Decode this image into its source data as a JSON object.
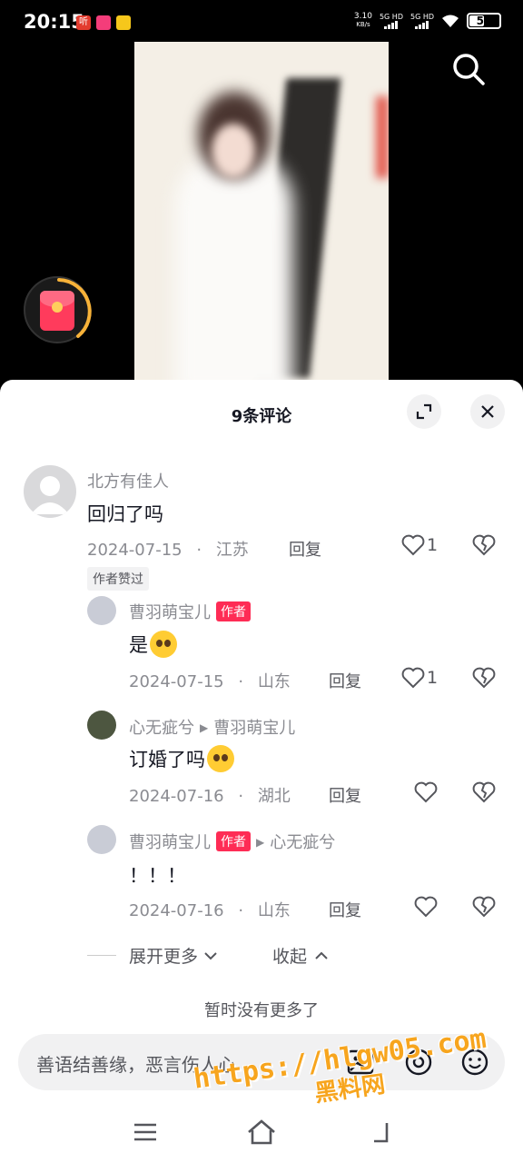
{
  "status_bar": {
    "time": "20:15",
    "net_speed": "3.10",
    "net_unit": "KB/s",
    "sim1": "5G HD",
    "sim2": "5G HD",
    "battery": "50",
    "app_icons": [
      {
        "name": "听",
        "color": "#e33b2e"
      },
      {
        "name": "",
        "color": "#f43d7a"
      },
      {
        "name": "",
        "color": "#f6c71b"
      }
    ]
  },
  "comments_sheet": {
    "title": "9条评论",
    "comments": [
      {
        "user": "北方有佳人",
        "text": "回归了吗",
        "date": "2024-07-15",
        "location": "江苏",
        "reply_label": "回复",
        "likes": "1",
        "badge": "作者赞过"
      }
    ],
    "replies": [
      {
        "user": "曹羽萌宝儿",
        "author_tag": "作者",
        "text": "是",
        "emoji": "pleading-face",
        "date": "2024-07-15",
        "location": "山东",
        "reply_label": "回复",
        "likes": "1"
      },
      {
        "user": "心无疵兮",
        "reply_to": "曹羽萌宝儿",
        "text": "订婚了吗",
        "emoji": "surprised-face",
        "date": "2024-07-16",
        "location": "湖北",
        "reply_label": "回复",
        "likes": ""
      },
      {
        "user": "曹羽萌宝儿",
        "author_tag": "作者",
        "reply_to": "心无疵兮",
        "text": "！！！",
        "date": "2024-07-16",
        "location": "山东",
        "reply_label": "回复",
        "likes": ""
      }
    ],
    "expand_more": "展开更多",
    "collapse": "收起",
    "no_more": "暂时没有更多了",
    "input_placeholder": "善语结善缘，恶言伤人心"
  },
  "watermark": {
    "url": "https://hlgw05.com",
    "name": "黑料网"
  },
  "colors": {
    "author_tag": "#fe2c55",
    "secondary_text": "#8a8b91",
    "watermark": "#f7a51e"
  }
}
